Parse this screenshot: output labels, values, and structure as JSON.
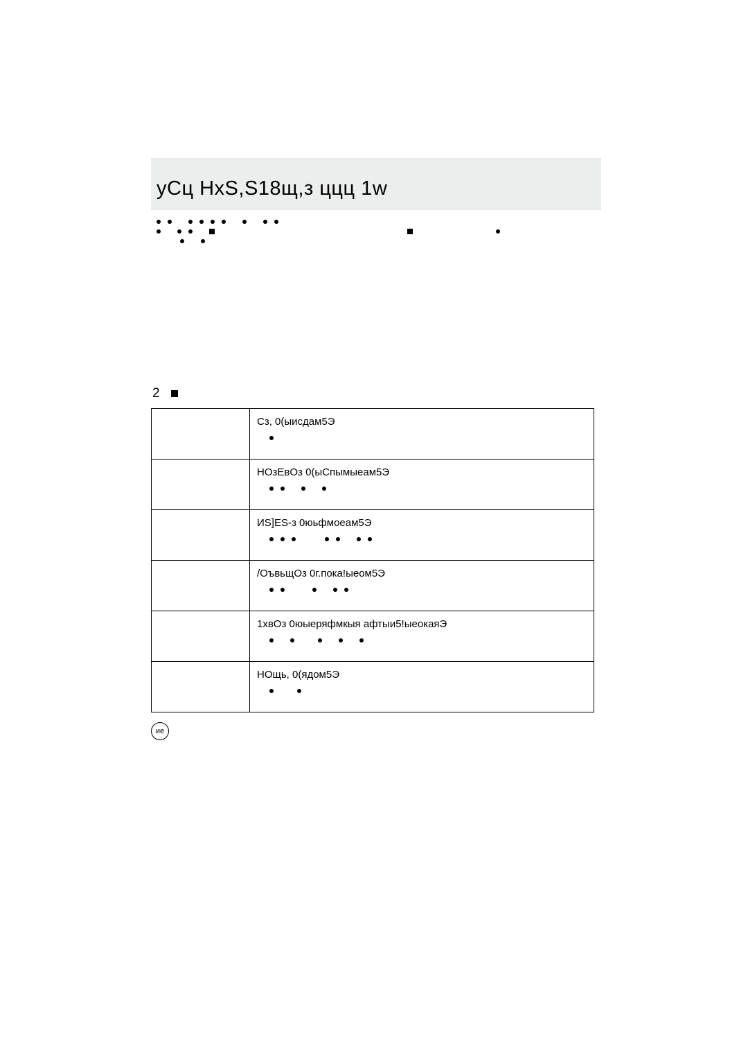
{
  "header": {
    "title": "уСц НхS,S18щ,з ццц 1w"
  },
  "section": {
    "number": "2"
  },
  "table": {
    "rows": [
      {
        "text": "Сз, 0(ыисдам5Э",
        "dotgroups": [
          [
            1
          ]
        ]
      },
      {
        "text": "НОзЕвОз 0(ыСпымыеам5Э",
        "dotgroups": [
          [
            1,
            1
          ],
          [
            1
          ],
          [
            1
          ]
        ]
      },
      {
        "text": "ИS]ES-з 0юьфмоеам5Э",
        "dotgroups": [
          [
            1,
            1,
            1
          ],
          [
            1,
            1
          ],
          [
            1,
            1
          ]
        ]
      },
      {
        "text": "/ОъвьщОз 0г.пока!ыеом5Э",
        "dotgroups": [
          [
            1,
            1
          ],
          [
            1
          ],
          [
            1,
            1
          ]
        ]
      },
      {
        "text": "1хвОз 0юыеряфмкыя афтыи5!ыеокаяЭ",
        "dotgroups": [
          [
            1
          ],
          [
            1
          ],
          [
            1
          ],
          [
            1
          ],
          [
            1
          ]
        ]
      },
      {
        "text": "НОщь, 0(ядом5Э",
        "dotgroups": [
          [
            1
          ],
          [
            1
          ]
        ]
      }
    ]
  },
  "footer": {
    "badge": "ие"
  }
}
